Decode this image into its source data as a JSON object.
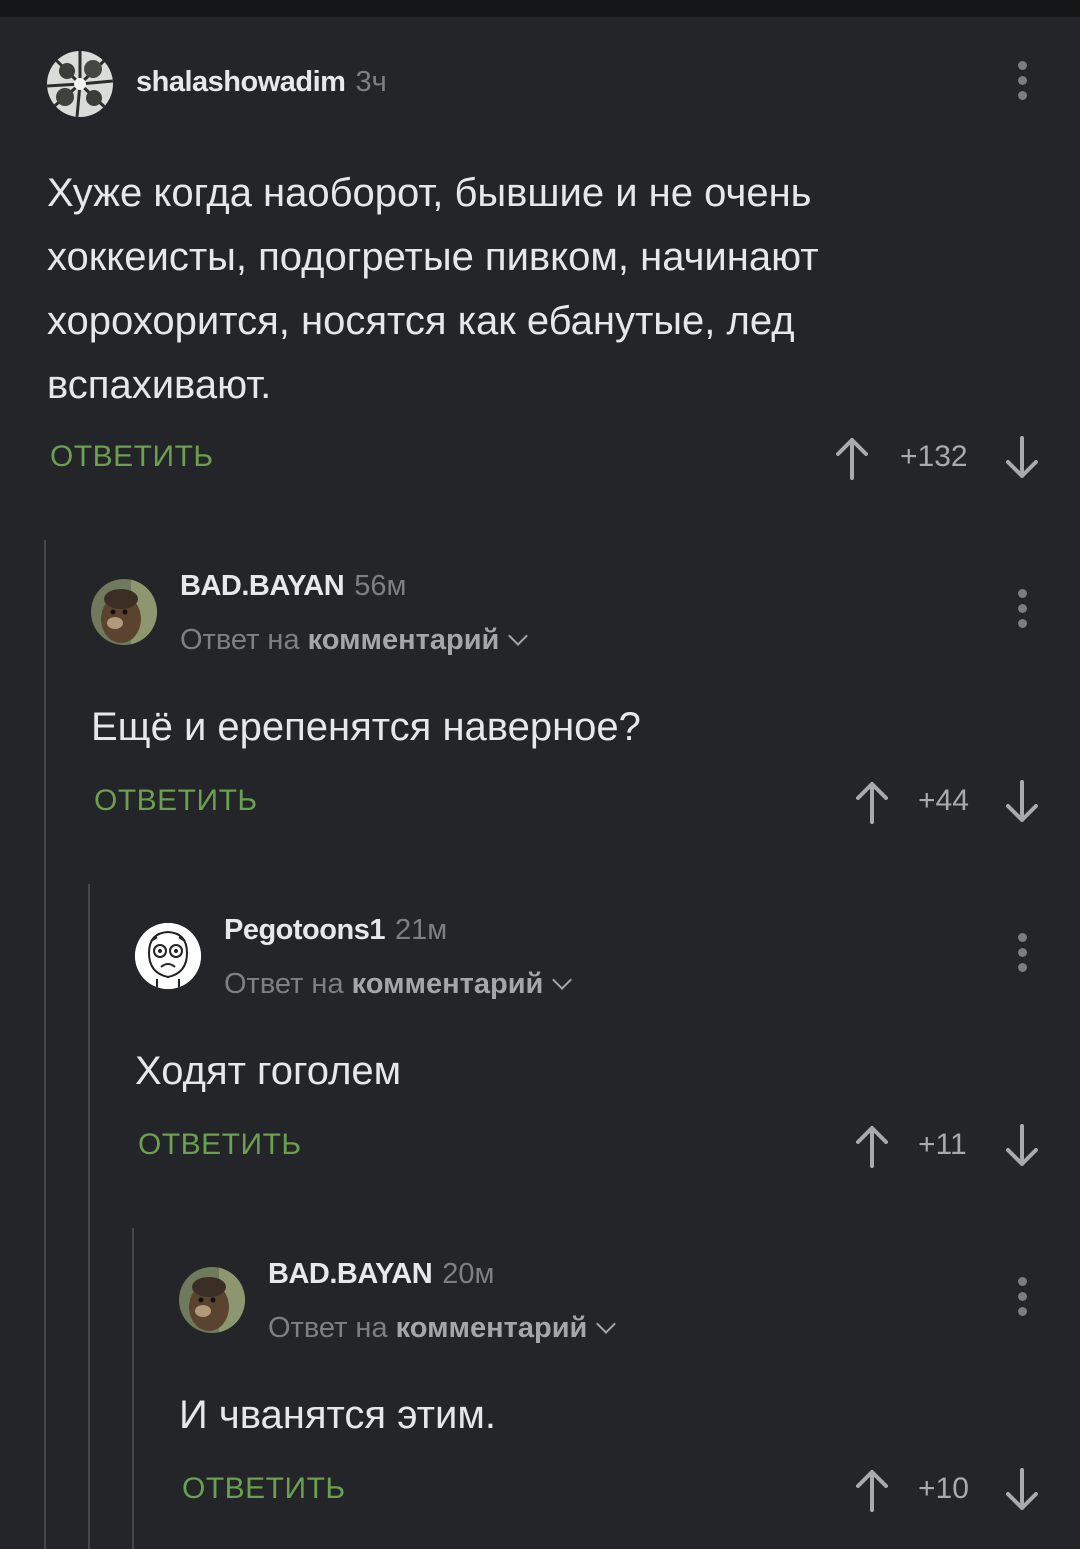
{
  "comments": [
    {
      "author": "shalashowadim",
      "time": "3ч",
      "body": "Хуже когда наоборот, бывшие и не очень хоккеисты, подогретые пивком, начинают хорохорится, носятся как ебанутые, лед вспахивают.",
      "reply_label": "ОТВЕТИТЬ",
      "score": "+132",
      "avatar_icon": "forest-canopy-avatar"
    },
    {
      "author": "BAD.BAYAN",
      "time": "56м",
      "reply_prefix": "Ответ на",
      "reply_target": "комментарий",
      "body": "Ещё и ерепенятся наверное?",
      "reply_label": "ОТВЕТИТЬ",
      "score": "+44",
      "avatar_icon": "marmot-avatar"
    },
    {
      "author": "Pegotoons1",
      "time": "21м",
      "reply_prefix": "Ответ на",
      "reply_target": "комментарий",
      "body": "Ходят гоголем",
      "reply_label": "ОТВЕТИТЬ",
      "score": "+11",
      "avatar_icon": "cartoon-face-avatar"
    },
    {
      "author": "BAD.BAYAN",
      "time": "20м",
      "reply_prefix": "Ответ на",
      "reply_target": "комментарий",
      "body": "И чванятся этим.",
      "reply_label": "ОТВЕТИТЬ",
      "score": "+10",
      "avatar_icon": "marmot-avatar"
    }
  ],
  "colors": {
    "background": "#232528",
    "reply_accent": "#6aa04f",
    "muted_text": "#7c7f84"
  }
}
